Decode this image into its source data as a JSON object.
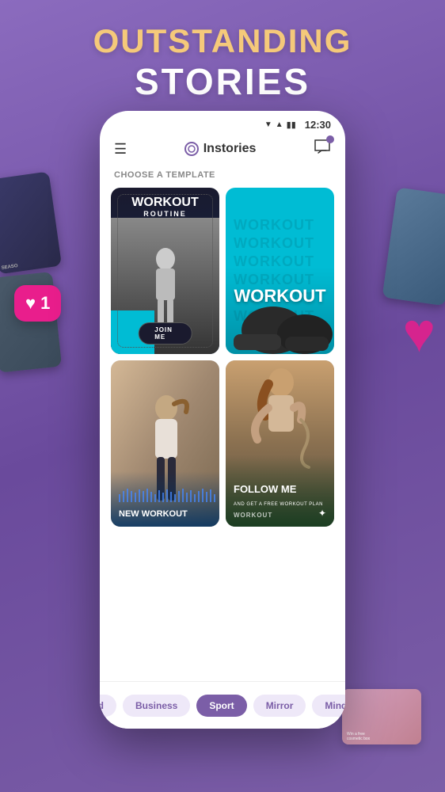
{
  "hero": {
    "line1": "OUTSTANDING",
    "line2": "STORIES"
  },
  "statusBar": {
    "time": "12:30",
    "signal": "▼",
    "wifi": "▲",
    "battery": "🔋"
  },
  "nav": {
    "logo": "Instories",
    "hamburger": "☰"
  },
  "section": {
    "choose_template": "CHOOSE A TEMPLATE"
  },
  "templates": [
    {
      "id": "workout-dark",
      "title": "WORKOUT",
      "subtitle": "ROUTINE",
      "cta": "JOIN ME"
    },
    {
      "id": "workout-cyan",
      "title": "WORKOUT"
    },
    {
      "id": "new-workout",
      "title": "NEW WORKOUT"
    },
    {
      "id": "follow-me",
      "title": "FOLLOW ME",
      "subtitle": "AND GET A FREE WORKOUT PLAN",
      "bottom": "WORKOUT"
    }
  ],
  "tabs": [
    {
      "id": "d",
      "label": "d",
      "active": false
    },
    {
      "id": "business",
      "label": "Business",
      "active": false
    },
    {
      "id": "sport",
      "label": "Sport",
      "active": true
    },
    {
      "id": "mirror",
      "label": "Mirror",
      "active": false
    },
    {
      "id": "mind",
      "label": "Mind",
      "active": false
    }
  ],
  "notification": {
    "count": "1"
  }
}
